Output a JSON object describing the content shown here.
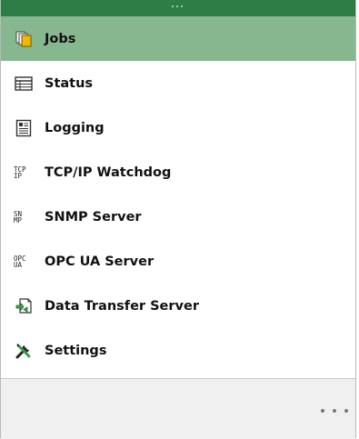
{
  "nav": {
    "items": [
      {
        "label": "Jobs",
        "icon": "jobs-icon",
        "active": true
      },
      {
        "label": "Status",
        "icon": "table-icon",
        "active": false
      },
      {
        "label": "Logging",
        "icon": "log-icon",
        "active": false
      },
      {
        "label": "TCP/IP Watchdog",
        "icon": "tcp-ip-icon",
        "icon_text": [
          "TCP",
          "IP"
        ],
        "active": false
      },
      {
        "label": "SNMP Server",
        "icon": "snmp-icon",
        "icon_text": [
          "SN",
          "MP"
        ],
        "active": false
      },
      {
        "label": "OPC UA Server",
        "icon": "opc-ua-icon",
        "icon_text": [
          "OPC",
          "UA"
        ],
        "active": false
      },
      {
        "label": "Data Transfer Server",
        "icon": "data-transfer-icon",
        "active": false
      },
      {
        "label": "Settings",
        "icon": "settings-tools-icon",
        "active": false
      }
    ]
  },
  "colors": {
    "header": "#2f7d46",
    "active_item": "#87b78e",
    "footer": "#f0f0f0"
  }
}
